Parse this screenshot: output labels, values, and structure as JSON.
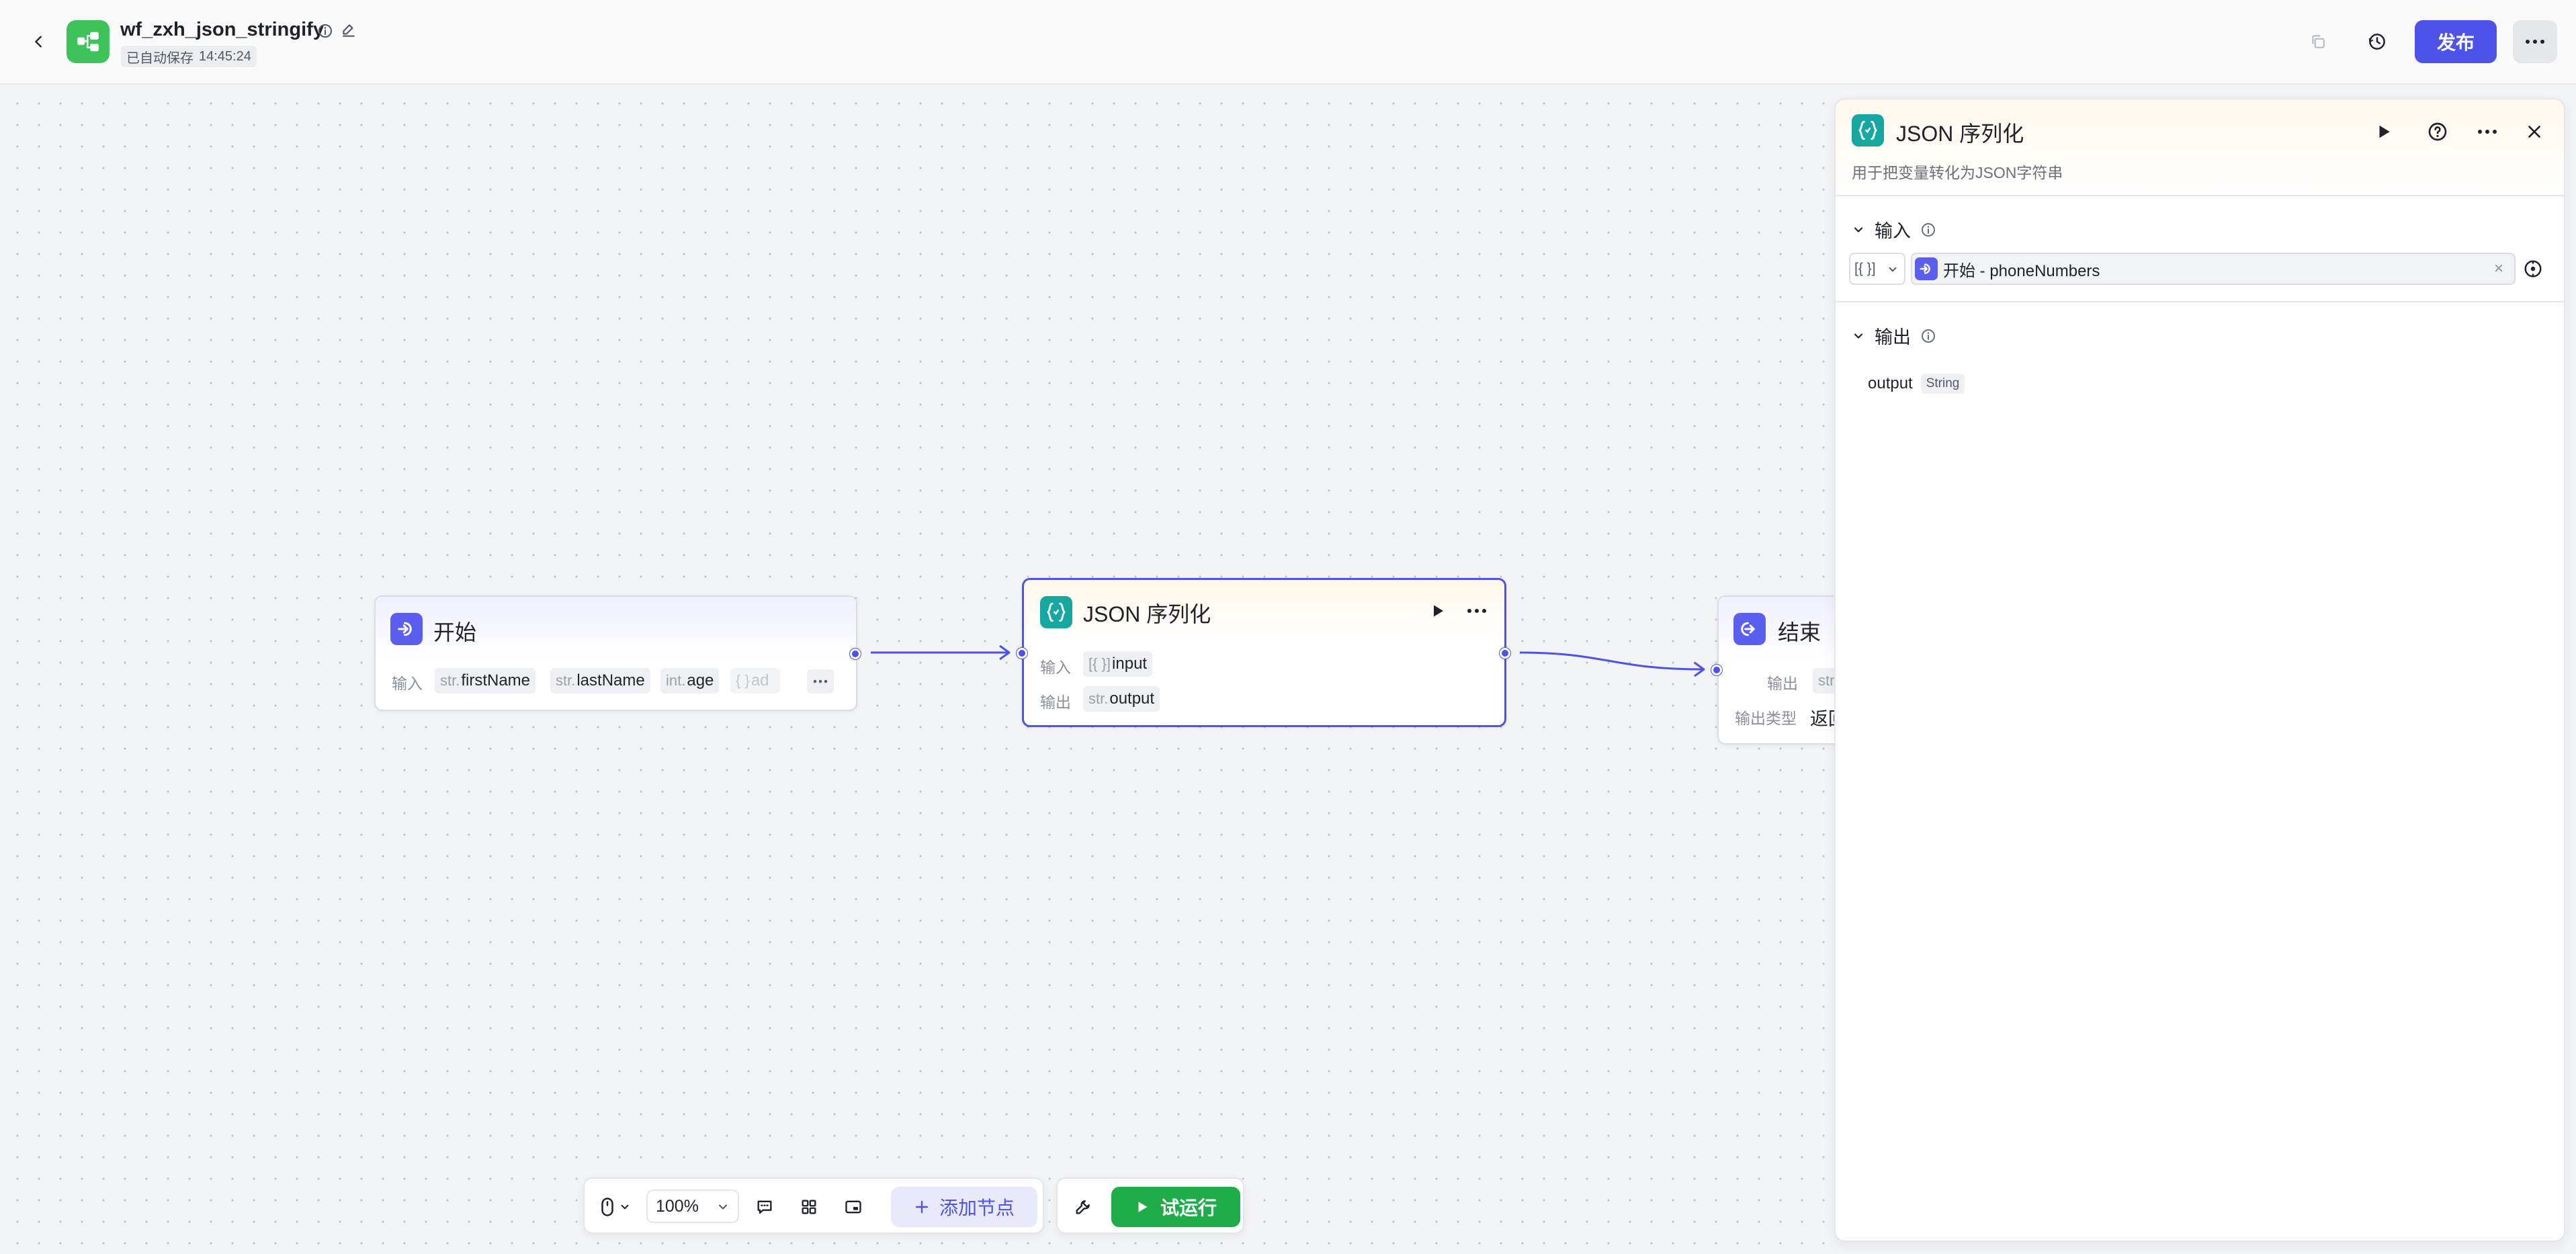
{
  "header": {
    "workflow_name": "wf_zxh_json_stringify",
    "autosave_label": "已自动保存",
    "autosave_time": "14:45:24",
    "publish_label": "发布"
  },
  "nodes": {
    "start": {
      "title": "开始",
      "input_label": "输入",
      "params": [
        {
          "type": "str.",
          "name": "firstName"
        },
        {
          "type": "str.",
          "name": "lastName"
        },
        {
          "type": "int.",
          "name": "age"
        },
        {
          "type": "{ }",
          "name": "ad"
        }
      ]
    },
    "json": {
      "title": "JSON 序列化",
      "input_label": "输入",
      "output_label": "输出",
      "input_param": {
        "type": "[{ }]",
        "name": "input"
      },
      "output_param": {
        "type": "str.",
        "name": "output"
      }
    },
    "end": {
      "title": "结束",
      "output_label": "输出",
      "output_param_type": "str.",
      "output_type_label": "输出类型",
      "output_type_value": "返回"
    }
  },
  "toolbar": {
    "zoom": "100%",
    "add_node_label": "添加节点",
    "run_label": "试运行"
  },
  "panel": {
    "title": "JSON 序列化",
    "description": "用于把变量转化为JSON字符串",
    "input_section": "输入",
    "output_section": "输出",
    "input_type": "[{ }]",
    "input_value": "开始 - phoneNumbers",
    "clear_symbol": "×",
    "output": {
      "name": "output",
      "type": "String"
    }
  },
  "colors": {
    "accent": "#4d53e8",
    "run_green": "#1fad4a",
    "app_green": "#3ec25a",
    "json_teal": "#16a8a0"
  }
}
